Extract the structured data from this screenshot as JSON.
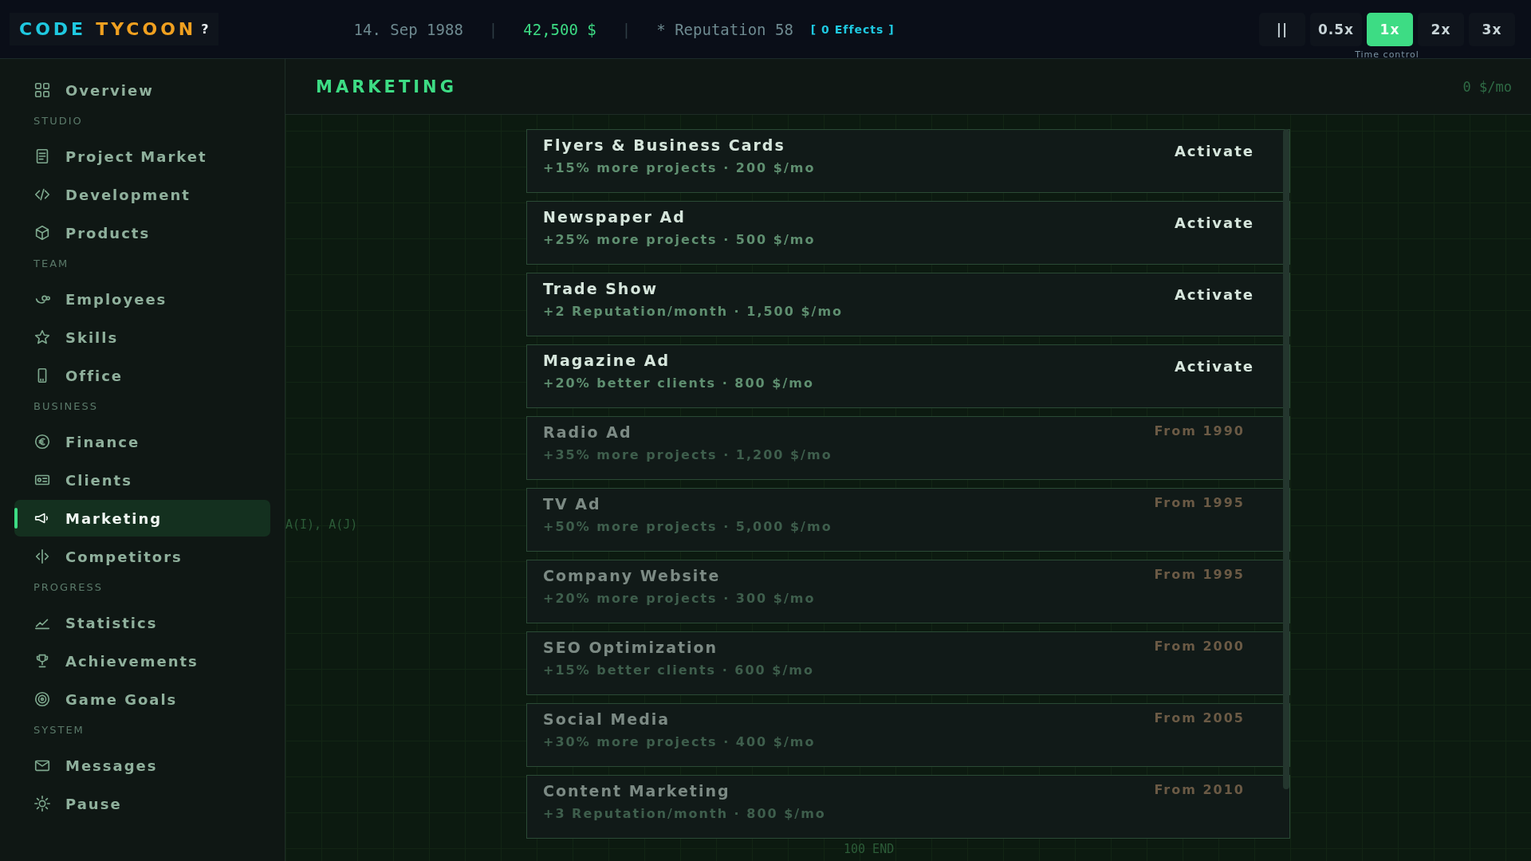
{
  "topbar": {
    "logo_first": "CODE",
    "logo_second": "TYCOON",
    "help": "?",
    "date": "14. Sep 1988",
    "separators": [
      "|",
      "|"
    ],
    "money": "42,500 $",
    "reputation": "* Reputation 58",
    "effects": "[ 0 Effects ]",
    "time_controls": [
      {
        "label": "||",
        "selected": false
      },
      {
        "label": "0.5x",
        "selected": false
      },
      {
        "label": "1x",
        "selected": true
      },
      {
        "label": "2x",
        "selected": false
      },
      {
        "label": "3x",
        "selected": false
      }
    ],
    "time_caption": "Time control"
  },
  "sidebar": {
    "sections": [
      {
        "items": [
          {
            "label": "Overview",
            "selected": false
          }
        ]
      },
      {
        "heading": "STUDIO",
        "items": [
          {
            "label": "Project Market",
            "selected": false
          },
          {
            "label": "Development",
            "selected": false
          },
          {
            "label": "Products",
            "selected": false
          }
        ]
      },
      {
        "heading": "TEAM",
        "items": [
          {
            "label": "Employees",
            "selected": false
          },
          {
            "label": "Skills",
            "selected": false
          },
          {
            "label": "Office",
            "selected": false
          }
        ]
      },
      {
        "heading": "BUSINESS",
        "items": [
          {
            "label": "Finance",
            "selected": false
          },
          {
            "label": "Clients",
            "selected": false
          },
          {
            "label": "Marketing",
            "selected": true
          },
          {
            "label": "Competitors",
            "selected": false
          }
        ]
      },
      {
        "heading": "PROGRESS",
        "items": [
          {
            "label": "Statistics",
            "selected": false
          },
          {
            "label": "Achievements",
            "selected": false
          },
          {
            "label": "Game Goals",
            "selected": false
          }
        ]
      },
      {
        "heading": "SYSTEM",
        "items": [
          {
            "label": "Messages",
            "selected": false
          },
          {
            "label": "Pause",
            "selected": false
          }
        ]
      }
    ]
  },
  "page": {
    "title": "MARKETING",
    "monthly_cost": "0 $/mo",
    "background_code": [
      "A(I), A(J)",
      "100 END"
    ],
    "campaigns": [
      {
        "title": "Flyers & Business Cards",
        "description": "+15% more projects · 200 $/mo",
        "action": "Activate",
        "locked": false
      },
      {
        "title": "Newspaper Ad",
        "description": "+25% more projects · 500 $/mo",
        "action": "Activate",
        "locked": false
      },
      {
        "title": "Trade Show",
        "description": "+2 Reputation/month · 1,500 $/mo",
        "action": "Activate",
        "locked": false
      },
      {
        "title": "Magazine Ad",
        "description": "+20% better clients · 800 $/mo",
        "action": "Activate",
        "locked": false
      },
      {
        "title": "Radio Ad",
        "description": "+35% more projects · 1,200 $/mo",
        "action": "From 1990",
        "locked": true
      },
      {
        "title": "TV Ad",
        "description": "+50% more projects · 5,000 $/mo",
        "action": "From 1995",
        "locked": true
      },
      {
        "title": "Company Website",
        "description": "+20% more projects · 300 $/mo",
        "action": "From 1995",
        "locked": true
      },
      {
        "title": "SEO Optimization",
        "description": "+15% better clients · 600 $/mo",
        "action": "From 2000",
        "locked": true
      },
      {
        "title": "Social Media",
        "description": "+30% more projects · 400 $/mo",
        "action": "From 2005",
        "locked": true
      },
      {
        "title": "Content Marketing",
        "description": "+3 Reputation/month · 800 $/mo",
        "action": "From 2010",
        "locked": true
      }
    ]
  }
}
